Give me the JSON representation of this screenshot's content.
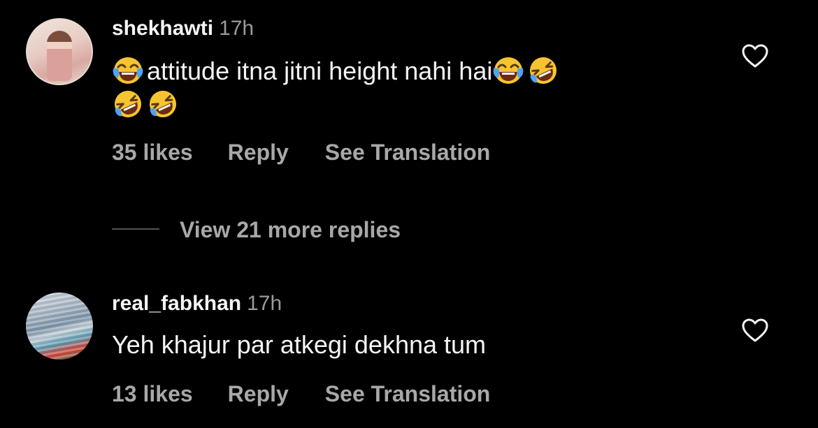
{
  "comments": [
    {
      "username": "shekhawti",
      "time": "17h",
      "text_part1": "attitude itna jitni height nahi hai",
      "likes": "35 likes",
      "reply_label": "Reply",
      "translate_label": "See Translation"
    },
    {
      "username": "real_fabkhan",
      "time": "17h",
      "text": "Yeh khajur par atkegi dekhna tum",
      "likes": "13 likes",
      "reply_label": "Reply",
      "translate_label": "See Translation"
    }
  ],
  "view_more_replies": "View 21 more replies",
  "icons": {
    "heart": "heart-icon",
    "emoji_joy": "face-with-tears-of-joy",
    "emoji_rofl": "rolling-on-the-floor-laughing"
  },
  "colors": {
    "background": "#000000",
    "primary_text": "#f5f5f5",
    "secondary_text": "#a8a8a8",
    "emoji_yellow": "#f7c431",
    "tear_blue": "#4fa3f0"
  }
}
